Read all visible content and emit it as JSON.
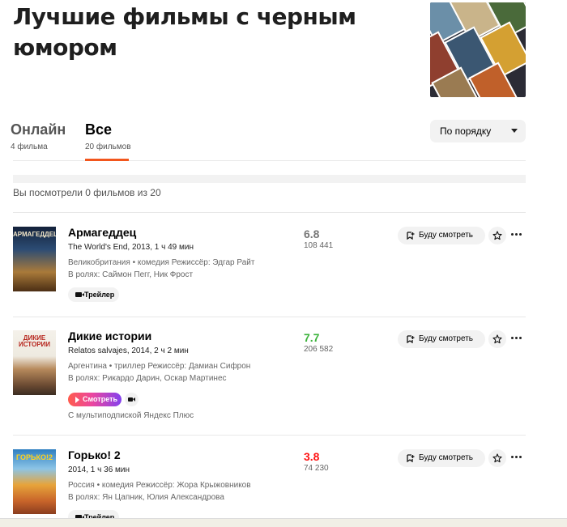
{
  "page": {
    "title": "Лучшие фильмы с черным юмором"
  },
  "tabs": [
    {
      "label": "Онлайн",
      "count": "4 фильма"
    },
    {
      "label": "Все",
      "count": "20 фильмов"
    }
  ],
  "sort": {
    "label": "По порядку"
  },
  "progress": {
    "watched_text": "Вы посмотрели 0 фильмов из 20",
    "watched": 0,
    "total": 20
  },
  "actions": {
    "watchlist_label": "Буду смотреть"
  },
  "colors": {
    "accent": "#f2561d",
    "rating_gray": "#777777",
    "rating_green": "#3bb33b",
    "rating_red": "#ff1414"
  },
  "films": [
    {
      "title": "Армагеддец",
      "original": "The World's End, 2013, 1 ч 49 мин",
      "meta": "Великобритания • комедия  Режиссёр: Эдгар Райт",
      "cast": "В ролях: Саймон Пегг, Ник Фрост",
      "rating": "6.8",
      "votes": "108 441",
      "trailer_label": "Трейлер",
      "poster_text": "АРМАГЕДДЕЦ"
    },
    {
      "title": "Дикие истории",
      "original": "Relatos salvajes, 2014, 2 ч 2 мин",
      "meta": "Аргентина • триллер  Режиссёр: Дамиан Сифрон",
      "cast": "В ролях: Рикардо Дарин, Оскар Мартинес",
      "rating": "7.7",
      "votes": "206 582",
      "watch_label": "Смотреть",
      "plus_note": "С мультиподпиской Яндекс Плюс",
      "poster_text": "ДИКИЕ ИСТОРИИ"
    },
    {
      "title": "Горько! 2",
      "original": "2014, 1 ч 36 мин",
      "meta": "Россия • комедия  Режиссёр: Жора Крыжовников",
      "cast": "В ролях: Ян Цапник, Юлия Александрова",
      "rating": "3.8",
      "votes": "74 230",
      "trailer_label": "Трейлер",
      "poster_text": "ГОРЬКО!2"
    }
  ]
}
